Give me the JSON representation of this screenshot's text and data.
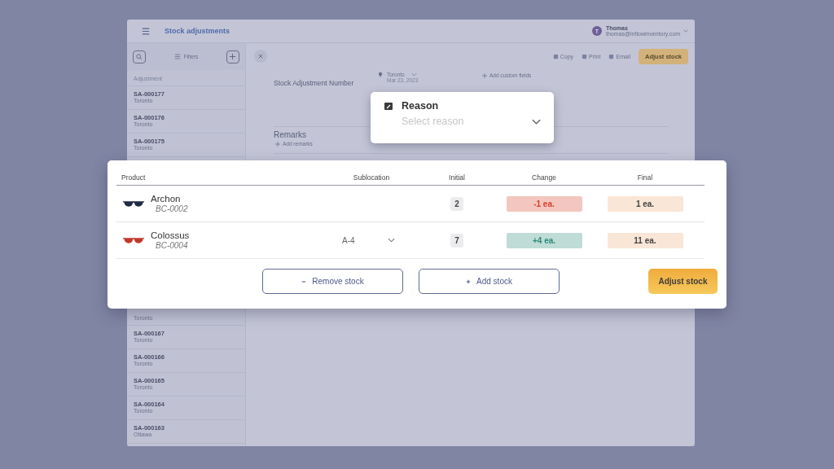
{
  "topbar": {
    "title": "Stock adjustments",
    "user": {
      "initial": "T",
      "name": "Thomas",
      "email": "thomas@inflowinventory.com"
    }
  },
  "sidebar": {
    "filters": "Filters",
    "column_header": "Adjustment",
    "items_top": [
      {
        "number": "SA-000177",
        "location": "Toronto"
      },
      {
        "number": "SA-000176",
        "location": "Toronto"
      },
      {
        "number": "SA-000175",
        "location": "Toronto"
      }
    ],
    "partial_item": {
      "location": "Toronto"
    },
    "items_bottom": [
      {
        "number": "SA-000167",
        "location": "Toronto"
      },
      {
        "number": "SA-000166",
        "location": "Toronto"
      },
      {
        "number": "SA-000165",
        "location": "Toronto"
      },
      {
        "number": "SA-000164",
        "location": "Toronto"
      },
      {
        "number": "SA-000163",
        "location": "Ottawa"
      }
    ]
  },
  "toolbar": {
    "actions": [
      "Copy",
      "Print",
      "Email"
    ],
    "primary": "Adjust stock"
  },
  "form": {
    "number_label": "Stock Adjustment Number",
    "location": "Toronto",
    "date": "Mar 23, 2023",
    "custom_fields": "Add custom fields",
    "remarks_label": "Remarks",
    "add_remarks": "Add remarks"
  },
  "reason": {
    "label": "Reason",
    "placeholder": "Select reason"
  },
  "table": {
    "columns": [
      "Product",
      "Sublocation",
      "Initial",
      "Change",
      "Final"
    ],
    "rows": [
      {
        "name": "Archon",
        "code": "BC-0002",
        "color": "#1f2a44",
        "initial": "2",
        "change": {
          "text": "-1 ea.",
          "color": "#d6402a"
        },
        "final": "1 ea."
      },
      {
        "name": "Colossus",
        "code": "BC-0004",
        "color": "#c0392b",
        "sublocation": "A-4",
        "initial": "7",
        "change": {
          "text": "+4 ea.",
          "color": "#2c8a7a"
        },
        "final": "11 ea."
      }
    ]
  },
  "buttons": {
    "remove": "Remove stock",
    "add": "Add stock",
    "adjust": "Adjust stock"
  }
}
